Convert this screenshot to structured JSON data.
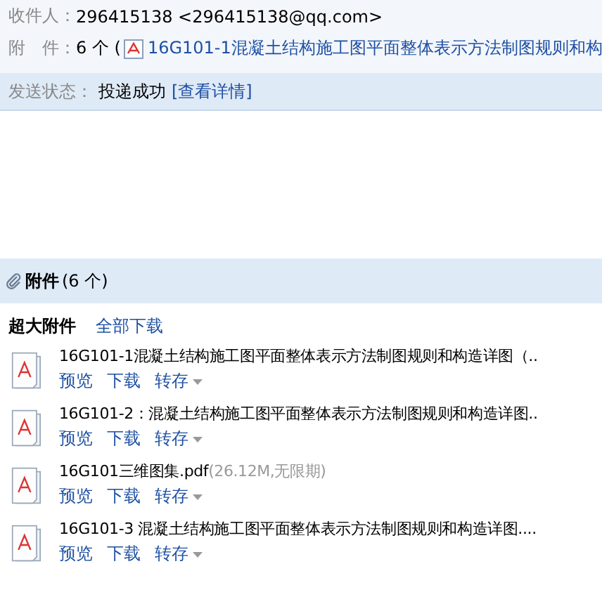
{
  "header": {
    "recipient_label": "收件人：",
    "recipient_value": "296415138 <296415138@qq.com>",
    "attachment_label": "附　件：",
    "attachment_count": "6 个 (",
    "attachment_first": "16G101-1混凝土结构施工图平面整体表示方法制图规则和构",
    "status_label": "发送状态：",
    "status_value": "投递成功",
    "status_link": "[查看详情]"
  },
  "attachments": {
    "title": "附件",
    "count": "(6 个)",
    "group_label": "超大附件",
    "download_all": "全部下载",
    "items": [
      {
        "name": "16G101-1混凝土结构施工图平面整体表示方法制图规则和构造详图（..",
        "actions": [
          "预览",
          "下载",
          "转存"
        ]
      },
      {
        "name": "16G101-2：混凝土结构施工图平面整体表示方法制图规则和构造详图..",
        "actions": [
          "预览",
          "下载",
          "转存"
        ]
      },
      {
        "name": "16G101三维图集.pdf",
        "meta": "(26.12M,无限期)",
        "actions": [
          "预览",
          "下载",
          "转存"
        ]
      },
      {
        "name": "16G101-3 混凝土结构施工图平面整体表示方法制图规则和构造详图....",
        "actions": [
          "预览",
          "下载",
          "转存"
        ]
      }
    ]
  }
}
